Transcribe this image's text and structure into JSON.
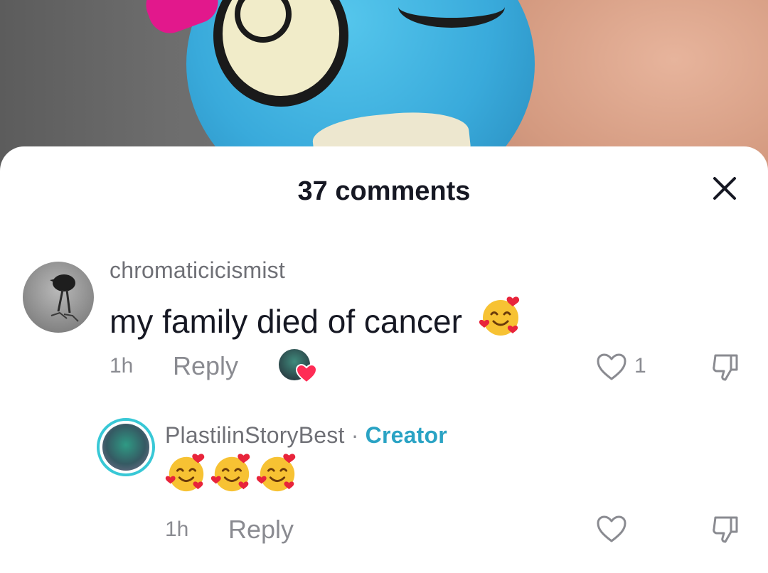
{
  "sheet": {
    "title": "37 comments"
  },
  "comments": [
    {
      "username": "chromaticicismist",
      "text": "my family died of cancer",
      "emoji": "smiling-face-with-hearts",
      "time": "1h",
      "reply_label": "Reply",
      "likes": "1",
      "liked_by_creator": true
    }
  ],
  "replies": [
    {
      "username": "PlastilinStoryBest",
      "separator": "·",
      "badge": "Creator",
      "emoji": [
        "smiling-face-with-hearts",
        "smiling-face-with-hearts",
        "smiling-face-with-hearts"
      ],
      "time": "1h",
      "reply_label": "Reply"
    }
  ],
  "colors": {
    "creator_badge": "#2aa3c4",
    "creator_ring": "#38c8d6",
    "heart_red": "#fe2c55",
    "muted_text": "#8a8b91"
  }
}
